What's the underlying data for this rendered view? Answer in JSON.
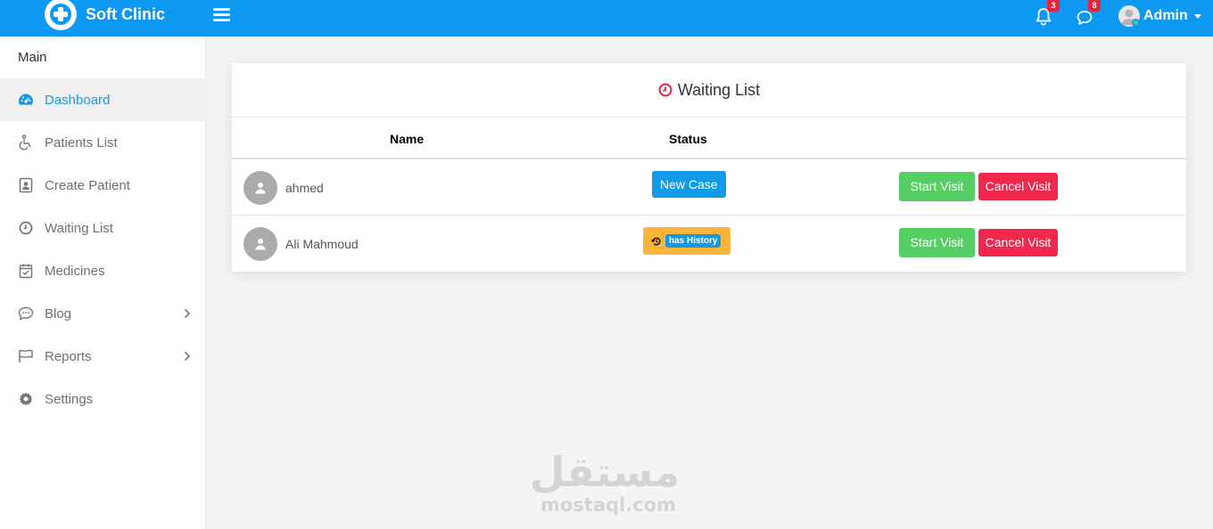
{
  "app": {
    "title": "Soft Clinic"
  },
  "topbar": {
    "notifications_count": "3",
    "messages_count": "8",
    "user_name": "Admin"
  },
  "sidebar": {
    "section_title": "Main",
    "items": [
      {
        "label": "Dashboard",
        "icon": "dashboard-icon",
        "active": true
      },
      {
        "label": "Patients List",
        "icon": "wheelchair-icon"
      },
      {
        "label": "Create Patient",
        "icon": "contact-card-icon"
      },
      {
        "label": "Waiting List",
        "icon": "clock-icon"
      },
      {
        "label": "Medicines",
        "icon": "calendar-check-icon"
      },
      {
        "label": "Blog",
        "icon": "chat-bubble-icon",
        "has_submenu": true
      },
      {
        "label": "Reports",
        "icon": "flag-icon",
        "has_submenu": true
      },
      {
        "label": "Settings",
        "icon": "gear-icon"
      }
    ]
  },
  "waiting_list": {
    "title": "Waiting List",
    "columns": [
      "Name",
      "Status"
    ],
    "rows": [
      {
        "name": "ahmed",
        "status": "New Case",
        "start_label": "Start Visit",
        "cancel_label": "Cancel Visit"
      },
      {
        "name": "Ali Mahmoud",
        "status": "has History",
        "start_label": "Start Visit",
        "cancel_label": "Cancel Visit"
      }
    ]
  },
  "watermark": {
    "arabic": "مستقل",
    "latin": "mostaql.com"
  },
  "colors": {
    "primary": "#0d99f2",
    "success": "#55ce63",
    "danger": "#f2274d",
    "warning": "#fcb43a",
    "info": "#119ae8"
  }
}
